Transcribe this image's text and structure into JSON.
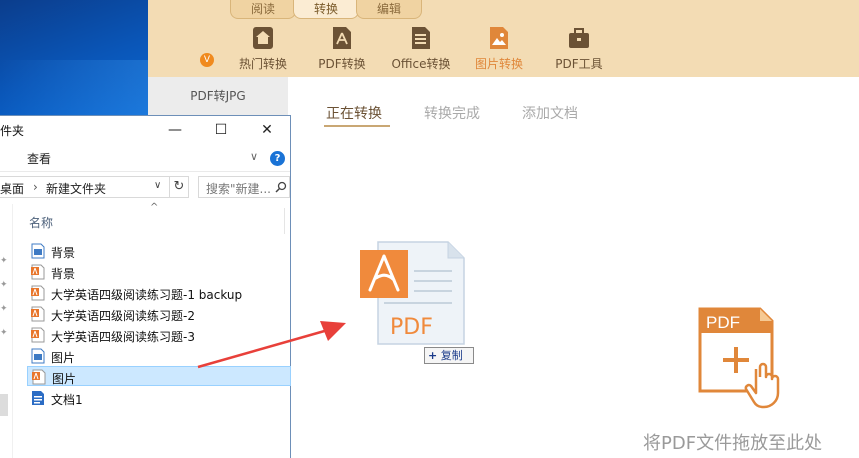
{
  "app": {
    "tabs": [
      "阅读",
      "转换",
      "编辑"
    ],
    "active_tab": "转换",
    "tools": [
      {
        "label": "热门转换",
        "icon": "home-icon"
      },
      {
        "label": "PDF转换",
        "icon": "pdf-doc-icon"
      },
      {
        "label": "Office转换",
        "icon": "office-doc-icon"
      },
      {
        "label": "图片转换",
        "icon": "image-doc-icon"
      },
      {
        "label": "PDF工具",
        "icon": "toolbox-icon"
      }
    ],
    "active_tool": "图片转换",
    "badge": "V",
    "left_panel": {
      "items": [
        "PDF转JPG"
      ]
    },
    "main_tabs": [
      "正在转换",
      "转换完成",
      "添加文档"
    ],
    "active_main_tab": "正在转换",
    "add_icon_label": "PDF",
    "drop_hint": "将PDF文件拖放至此处",
    "accent_color": "#e0873a"
  },
  "drag": {
    "ghost_label": "PDF",
    "copy_tip_plus": "+",
    "copy_tip": "复制"
  },
  "explorer": {
    "title": "件夹",
    "ribbon_tab": "查看",
    "help": "?",
    "address": {
      "crumbs": [
        "桌面",
        "新建文件夹"
      ]
    },
    "search_placeholder": "搜索\"新建...",
    "column_name": "名称",
    "files": [
      {
        "name": "背景",
        "type": "image"
      },
      {
        "name": "背景",
        "type": "pdf"
      },
      {
        "name": "大学英语四级阅读练习题-1 backup",
        "type": "pdf"
      },
      {
        "name": "大学英语四级阅读练习题-2",
        "type": "pdf"
      },
      {
        "name": "大学英语四级阅读练习题-3",
        "type": "pdf"
      },
      {
        "name": "图片",
        "type": "image"
      },
      {
        "name": "图片",
        "type": "pdf",
        "selected": true
      },
      {
        "name": "文档1",
        "type": "word"
      }
    ]
  }
}
